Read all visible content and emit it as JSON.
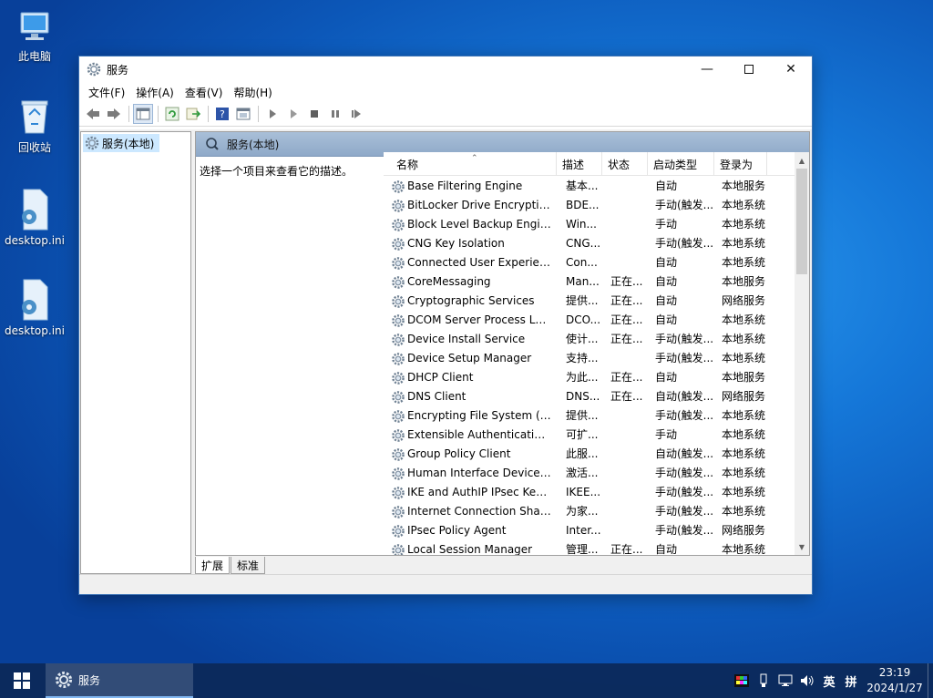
{
  "desktop": {
    "icons": [
      {
        "label": "此电脑"
      },
      {
        "label": "回收站"
      },
      {
        "label": "desktop.ini"
      },
      {
        "label": "desktop.ini"
      }
    ]
  },
  "window": {
    "title": "服务",
    "menu": [
      "文件(F)",
      "操作(A)",
      "查看(V)",
      "帮助(H)"
    ],
    "tree_item": "服务(本地)",
    "panel_header": "服务(本地)",
    "description_hint": "选择一个项目来查看它的描述。",
    "columns": {
      "name": "名称",
      "desc": "描述",
      "status": "状态",
      "startup": "启动类型",
      "logon": "登录为"
    },
    "rows": [
      {
        "name": "Base Filtering Engine",
        "desc": "基本...",
        "status": "",
        "startup": "自动",
        "logon": "本地服务"
      },
      {
        "name": "BitLocker Drive Encryption Service",
        "desc": "BDE...",
        "status": "",
        "startup": "手动(触发...",
        "logon": "本地系统"
      },
      {
        "name": "Block Level Backup Engine Service",
        "desc": "Win...",
        "status": "",
        "startup": "手动",
        "logon": "本地系统"
      },
      {
        "name": "CNG Key Isolation",
        "desc": "CNG...",
        "status": "",
        "startup": "手动(触发...",
        "logon": "本地系统"
      },
      {
        "name": "Connected User Experiences and Telemetry",
        "desc": "Con...",
        "status": "",
        "startup": "自动",
        "logon": "本地系统"
      },
      {
        "name": "CoreMessaging",
        "desc": "Man...",
        "status": "正在...",
        "startup": "自动",
        "logon": "本地服务"
      },
      {
        "name": "Cryptographic Services",
        "desc": "提供...",
        "status": "正在...",
        "startup": "自动",
        "logon": "网络服务"
      },
      {
        "name": "DCOM Server Process Launcher",
        "desc": "DCO...",
        "status": "正在...",
        "startup": "自动",
        "logon": "本地系统"
      },
      {
        "name": "Device Install Service",
        "desc": "使计...",
        "status": "正在...",
        "startup": "手动(触发...",
        "logon": "本地系统"
      },
      {
        "name": "Device Setup Manager",
        "desc": "支持...",
        "status": "",
        "startup": "手动(触发...",
        "logon": "本地系统"
      },
      {
        "name": "DHCP Client",
        "desc": "为此...",
        "status": "正在...",
        "startup": "自动",
        "logon": "本地服务"
      },
      {
        "name": "DNS Client",
        "desc": "DNS...",
        "status": "正在...",
        "startup": "自动(触发...",
        "logon": "网络服务"
      },
      {
        "name": "Encrypting File System (EFS)",
        "desc": "提供...",
        "status": "",
        "startup": "手动(触发...",
        "logon": "本地系统"
      },
      {
        "name": "Extensible Authentication Protocol",
        "desc": "可扩...",
        "status": "",
        "startup": "手动",
        "logon": "本地系统"
      },
      {
        "name": "Group Policy Client",
        "desc": "此服...",
        "status": "",
        "startup": "自动(触发...",
        "logon": "本地系统"
      },
      {
        "name": "Human Interface Device Service",
        "desc": "激活...",
        "status": "",
        "startup": "手动(触发...",
        "logon": "本地系统"
      },
      {
        "name": "IKE and AuthIP IPsec Keying Modules",
        "desc": "IKEE...",
        "status": "",
        "startup": "手动(触发...",
        "logon": "本地系统"
      },
      {
        "name": "Internet Connection Sharing (ICS)",
        "desc": "为家...",
        "status": "",
        "startup": "手动(触发...",
        "logon": "本地系统"
      },
      {
        "name": "IPsec Policy Agent",
        "desc": "Inter...",
        "status": "",
        "startup": "手动(触发...",
        "logon": "网络服务"
      },
      {
        "name": "Local Session Manager",
        "desc": "管理...",
        "status": "正在...",
        "startup": "自动",
        "logon": "本地系统"
      }
    ],
    "tabs": [
      "扩展",
      "标准"
    ]
  },
  "taskbar": {
    "app_label": "服务",
    "ime_lang": "英",
    "ime_mode": "拼",
    "time": "23:19",
    "date": "2024/1/27"
  }
}
